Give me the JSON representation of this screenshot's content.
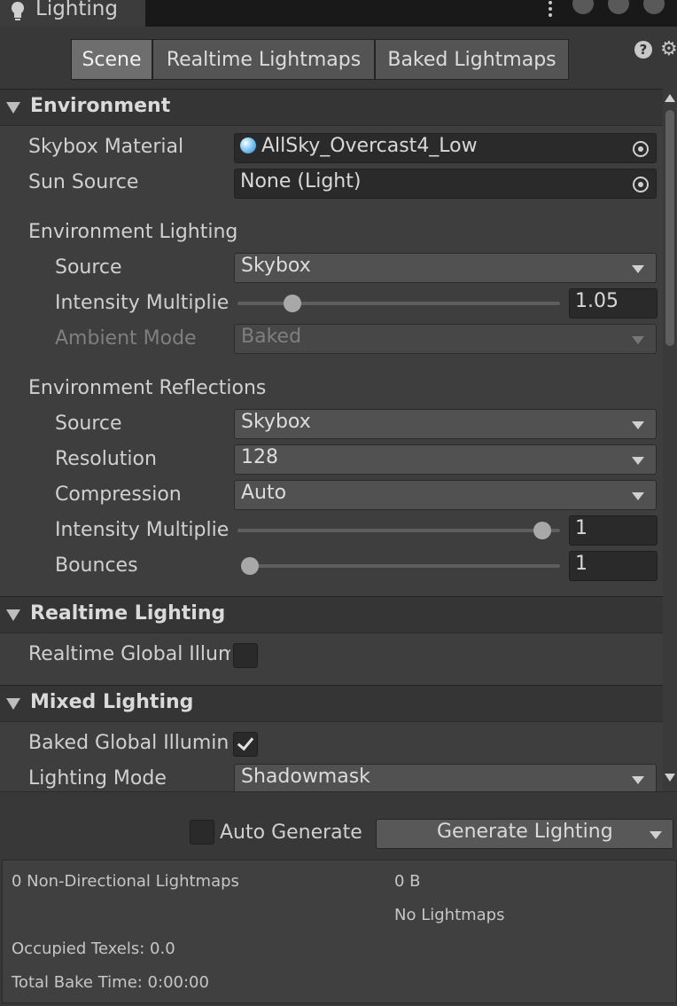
{
  "window": {
    "title": "Lighting",
    "icons": {
      "title": "lightbulb-icon",
      "menu": "kebab-menu-icon",
      "help": "help-icon",
      "settings": "gear-icon"
    }
  },
  "tabs": [
    {
      "label": "Scene",
      "active": true
    },
    {
      "label": "Realtime Lightmaps",
      "active": false
    },
    {
      "label": "Baked Lightmaps",
      "active": false
    }
  ],
  "environment": {
    "header": "Environment",
    "skybox_material": {
      "label": "Skybox Material",
      "value": "AllSky_Overcast4_Low"
    },
    "sun_source": {
      "label": "Sun Source",
      "value": "None (Light)"
    },
    "lighting": {
      "heading": "Environment Lighting",
      "source": {
        "label": "Source",
        "value": "Skybox"
      },
      "intensity": {
        "label": "Intensity Multiplie",
        "value": "1.05",
        "slider_fraction": 0.15
      },
      "ambient_mode": {
        "label": "Ambient Mode",
        "value": "Baked"
      }
    },
    "reflections": {
      "heading": "Environment Reflections",
      "source": {
        "label": "Source",
        "value": "Skybox"
      },
      "resolution": {
        "label": "Resolution",
        "value": "128"
      },
      "compression": {
        "label": "Compression",
        "value": "Auto"
      },
      "intensity": {
        "label": "Intensity Multiplie",
        "value": "1",
        "slider_fraction": 0.97
      },
      "bounces": {
        "label": "Bounces",
        "value": "1",
        "slider_fraction": 0.0
      }
    }
  },
  "realtime": {
    "header": "Realtime Lighting",
    "gi": {
      "label": "Realtime Global Illum",
      "checked": false
    }
  },
  "mixed": {
    "header": "Mixed Lighting",
    "baked_gi": {
      "label": "Baked Global Illumin",
      "checked": true
    },
    "mode": {
      "label": "Lighting Mode",
      "value": "Shadowmask"
    }
  },
  "footer": {
    "auto_generate": {
      "label": "Auto Generate",
      "checked": false
    },
    "generate_button": "Generate Lighting",
    "stats": {
      "lightmaps": "0 Non-Directional Lightmaps",
      "size": "0 B",
      "no_lightmaps": "No Lightmaps",
      "texels": "Occupied Texels: 0.0",
      "bake_time": "Total Bake Time: 0:00:00"
    }
  }
}
